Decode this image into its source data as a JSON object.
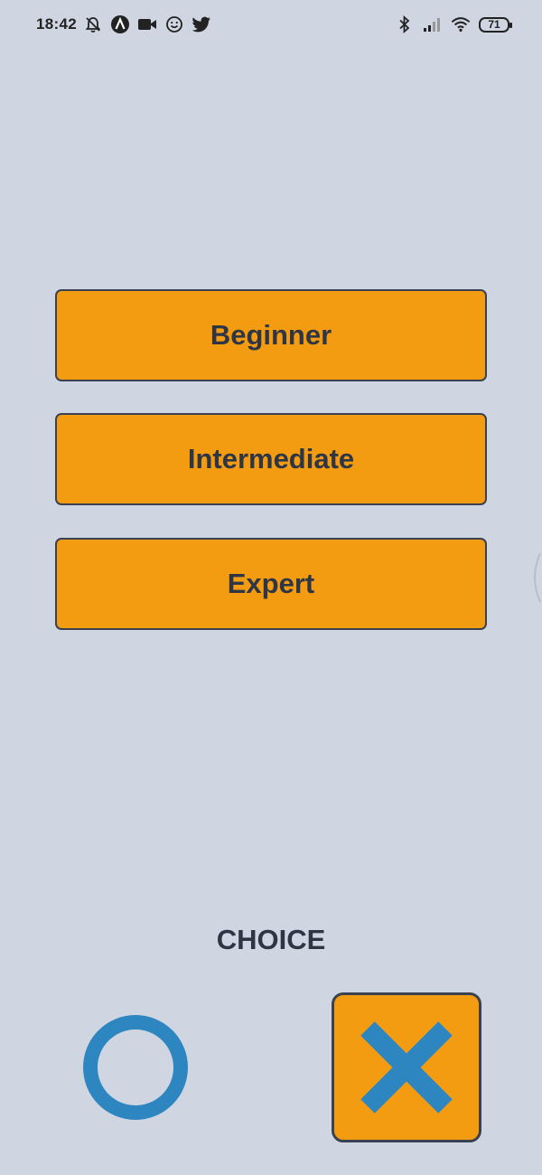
{
  "status_bar": {
    "time": "18:42",
    "battery": "71",
    "left_icons": [
      "alarm-off-icon",
      "app-icon",
      "video-camera-icon",
      "smiley-icon",
      "twitter-icon"
    ],
    "right_icons": [
      "bluetooth-icon",
      "signal-icon",
      "wifi-icon",
      "battery-icon"
    ]
  },
  "levels": {
    "beginner": "Beginner",
    "intermediate": "Intermediate",
    "expert": "Expert"
  },
  "choice": {
    "label": "CHOICE",
    "options": [
      "o-symbol",
      "x-symbol"
    ],
    "selected": "x-symbol"
  },
  "colors": {
    "background": "#d0d6e1",
    "button": "#f39c12",
    "border": "#3a4150",
    "text": "#2e3646",
    "symbol": "#2e86c1"
  }
}
